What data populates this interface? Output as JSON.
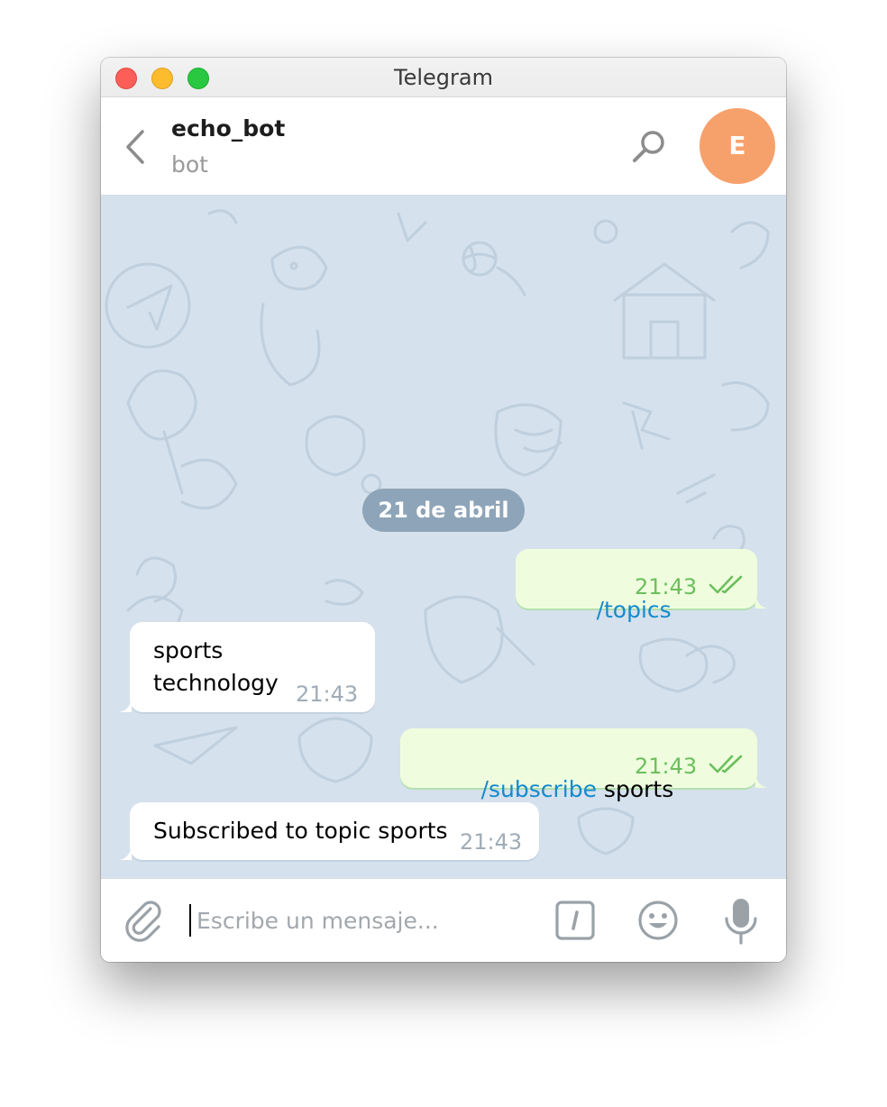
{
  "window": {
    "title": "Telegram"
  },
  "header": {
    "chat_name": "echo_bot",
    "chat_status": "bot",
    "avatar_letter": "E",
    "avatar_color": "#f6a16c"
  },
  "chat": {
    "date_separator": "21 de abril",
    "messages": [
      {
        "direction": "out",
        "command": "/topics",
        "text": "",
        "time": "21:43",
        "status": "read"
      },
      {
        "direction": "in",
        "command": "",
        "text": "sports\ntechnology",
        "time": "21:43"
      },
      {
        "direction": "out",
        "command": "/subscribe",
        "text": " sports",
        "time": "21:43",
        "status": "read"
      },
      {
        "direction": "in",
        "command": "",
        "text": "Subscribed to topic sports",
        "time": "21:43"
      }
    ]
  },
  "composer": {
    "placeholder": "Escribe un mensaje...",
    "value": ""
  },
  "icons": {
    "back": "chevron-left-icon",
    "search": "search-icon",
    "attach": "paperclip-icon",
    "commands": "slash-command-icon",
    "emoji": "smiley-icon",
    "voice": "microphone-icon"
  },
  "colors": {
    "chat_background": "#d5e1ec",
    "outgoing_bubble": "#effdde",
    "incoming_bubble": "#ffffff",
    "command_link": "#168acd",
    "outgoing_time": "#6cbf5d",
    "date_pill": "#8ea4b8"
  }
}
